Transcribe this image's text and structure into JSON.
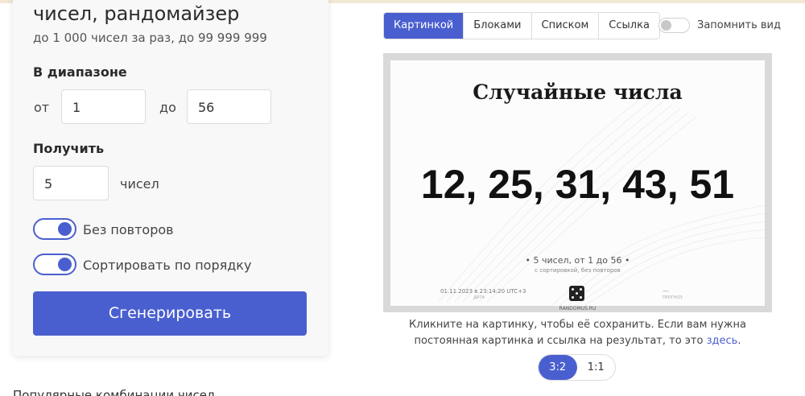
{
  "generator": {
    "title": "чисел, рандомайзер",
    "subtitle": "до 1 000 чисел за раз, до 99 999 999",
    "range_label": "В диапазоне",
    "from_label": "от",
    "from_value": "1",
    "to_label": "до",
    "to_value": "56",
    "get_label": "Получить",
    "count_value": "5",
    "count_unit": "чисел",
    "no_repeat_label": "Без повторов",
    "no_repeat_on": true,
    "sort_label": "Сортировать по порядку",
    "sort_on": true,
    "generate_label": "Сгенерировать"
  },
  "popular_heading": "Популярные комбинации чисел",
  "view": {
    "tabs": [
      "Картинкой",
      "Блоками",
      "Списком",
      "Ссылка"
    ],
    "active_tab": "Картинкой",
    "remember_label": "Запомнить вид",
    "remember_on": false
  },
  "picture": {
    "title": "Случайные числа",
    "numbers": "12, 25, 31, 43, 51",
    "meta": "•  5 чисел, от 1 до 56  •",
    "meta2": "с сортировкой, без повторов",
    "date": "01.11.2023 в 23:14:20 UTC+3",
    "date_caption": "ДАТА",
    "brand": "RANDOMUS.RU",
    "forecast_dash": "—",
    "forecast_caption": "ПРОГНОЗ"
  },
  "hint": {
    "text": "Кликните на картинку, чтобы её сохранить. Если вам нужна постоянная картинка и ссылка на результат, то это",
    "link": "здесь",
    "end": "."
  },
  "ratio": {
    "options": [
      "3:2",
      "1:1"
    ],
    "active": "3:2"
  },
  "colors": {
    "accent": "#4a5fcf",
    "card_bg": "#f8f8f8"
  }
}
